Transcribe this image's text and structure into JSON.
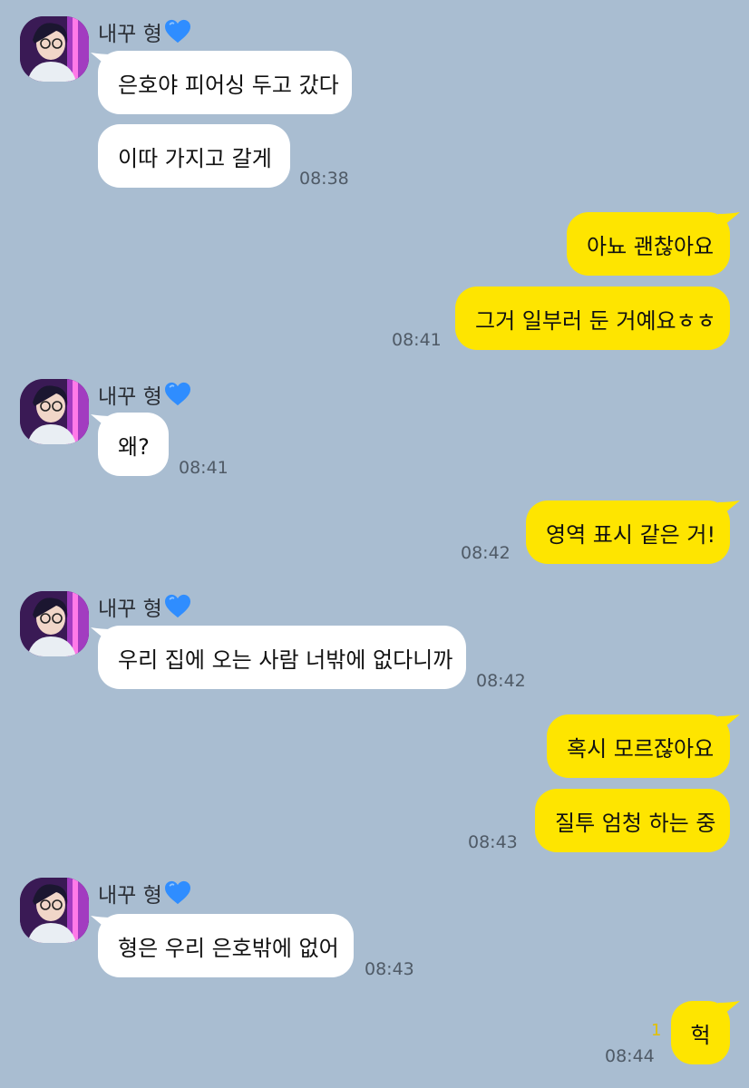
{
  "sender_name": "내꾸 형",
  "sender_emoji_icon": "blue-heart-icon",
  "colors": {
    "background": "#a9bdd1",
    "incoming_bubble": "#ffffff",
    "outgoing_bubble": "#fee500",
    "unread_count": "#e2c000"
  },
  "messages": [
    {
      "direction": "in",
      "text": "은호야 피어싱 두고 갔다"
    },
    {
      "direction": "in",
      "text": "이따 가지고 갈게",
      "time": "08:38"
    },
    {
      "direction": "out",
      "text": "아뇨 괜찮아요"
    },
    {
      "direction": "out",
      "text": "그거 일부러 둔 거예요ㅎㅎ",
      "time": "08:41"
    },
    {
      "direction": "in",
      "text": "왜?",
      "time": "08:41"
    },
    {
      "direction": "out",
      "text": "영역 표시 같은 거!",
      "time": "08:42"
    },
    {
      "direction": "in",
      "text": "우리 집에 오는 사람 너밖에 없다니까",
      "time": "08:42"
    },
    {
      "direction": "out",
      "text": "혹시 모르잖아요"
    },
    {
      "direction": "out",
      "text": "질투 엄청 하는 중",
      "time": "08:43"
    },
    {
      "direction": "in",
      "text": "형은 우리 은호밖에 없어",
      "time": "08:43"
    },
    {
      "direction": "out",
      "text": "헉",
      "time": "08:44",
      "unread": "1"
    }
  ]
}
